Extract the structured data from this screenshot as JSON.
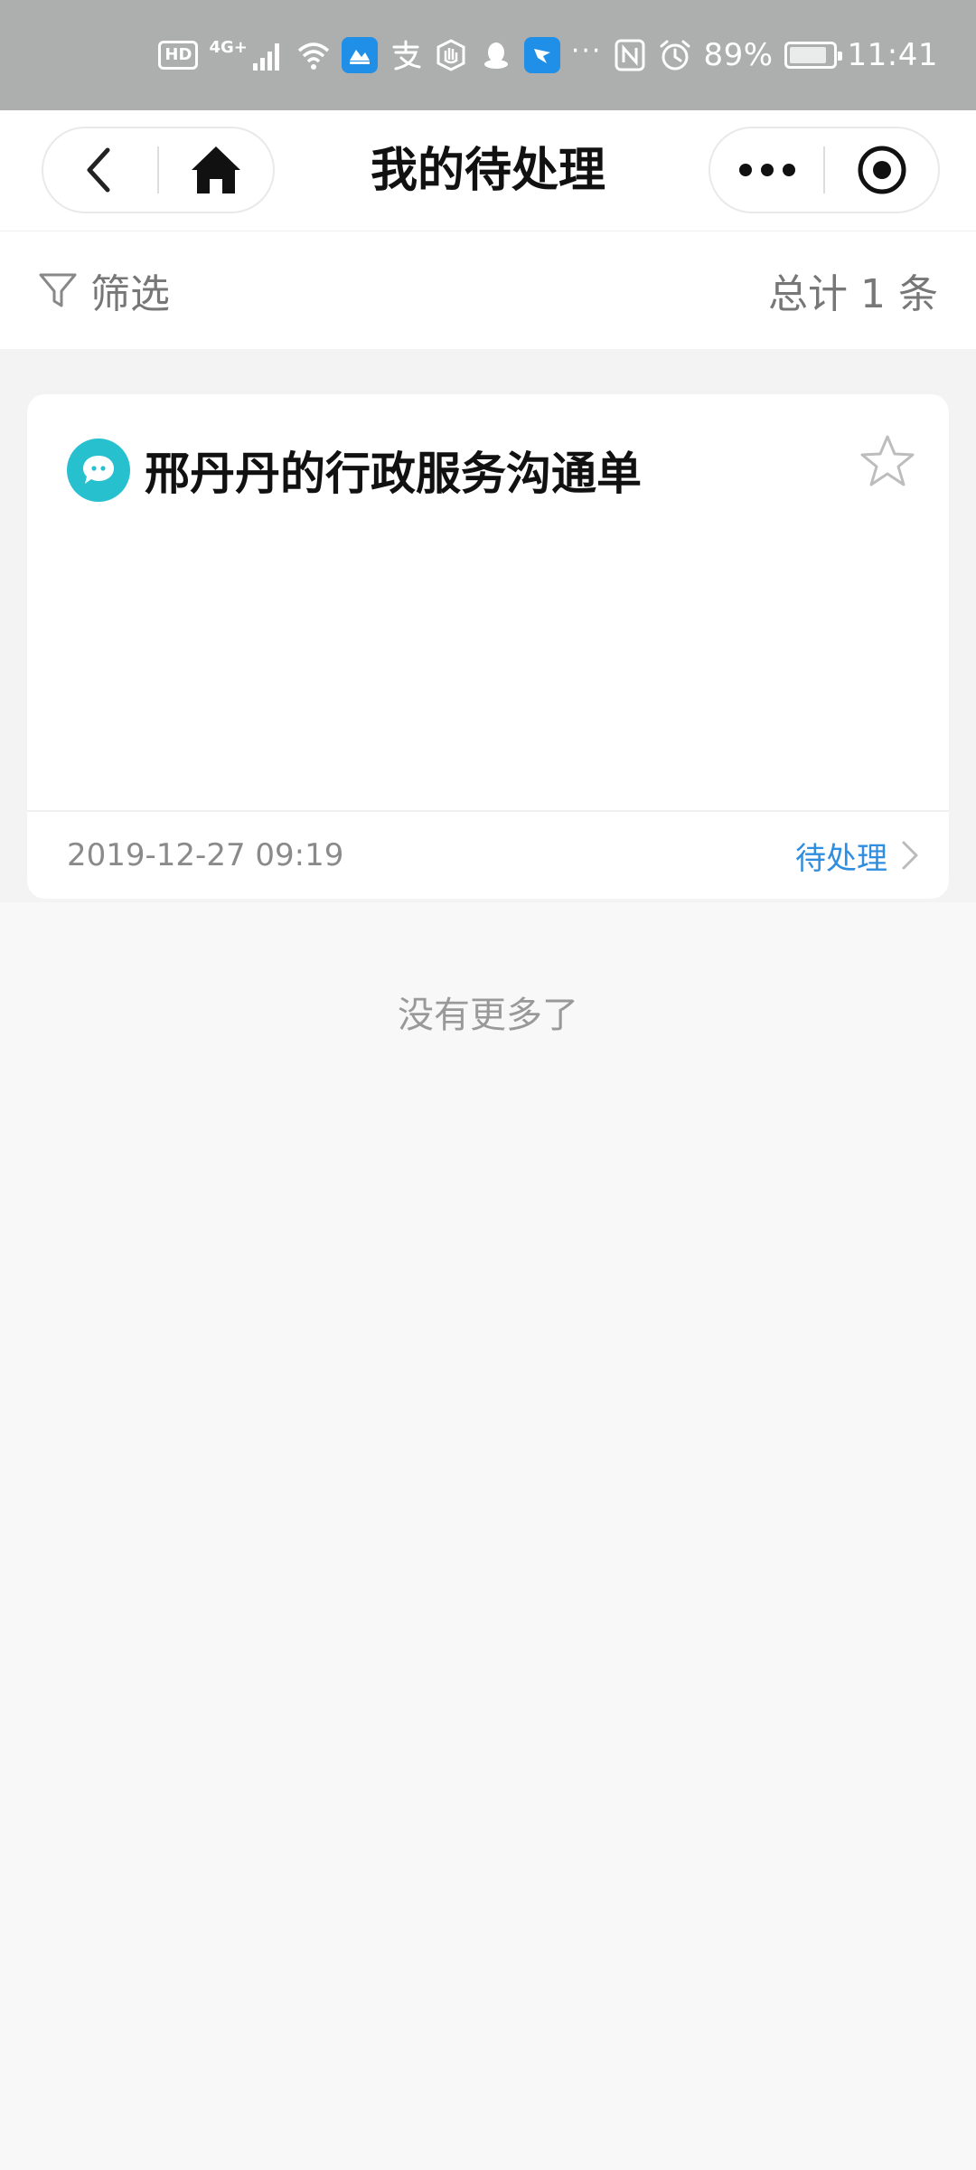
{
  "status_bar": {
    "hd_badge": "HD",
    "network": "4G+",
    "overflow": "···",
    "battery": "89%",
    "battery_level": 0.89,
    "time": "11:41",
    "icons": [
      "signal-icon",
      "wifi-icon",
      "app-notification-icon",
      "alipay-icon",
      "shield-app-icon",
      "qq-icon",
      "dingtalk-icon",
      "nfc-icon",
      "alarm-icon",
      "battery-icon"
    ]
  },
  "nav": {
    "title": "我的待处理",
    "icons": [
      "back-arrow-icon",
      "home-icon",
      "more-dots-icon",
      "close-target-icon"
    ]
  },
  "filter": {
    "label": "筛选",
    "total": "总计 1 条"
  },
  "items": [
    {
      "title": "邢丹丹的行政服务沟通单",
      "time": "2019-12-27 09:19",
      "status": "待处理",
      "avatar_color": "#26c0cf",
      "starred": false
    }
  ],
  "footer": {
    "no_more": "没有更多了"
  },
  "colors": {
    "status_bar_bg": "#adaeae",
    "accent": "#2f8ee0",
    "avatar": "#26c0cf",
    "page_bg": "#f8f8f8"
  }
}
